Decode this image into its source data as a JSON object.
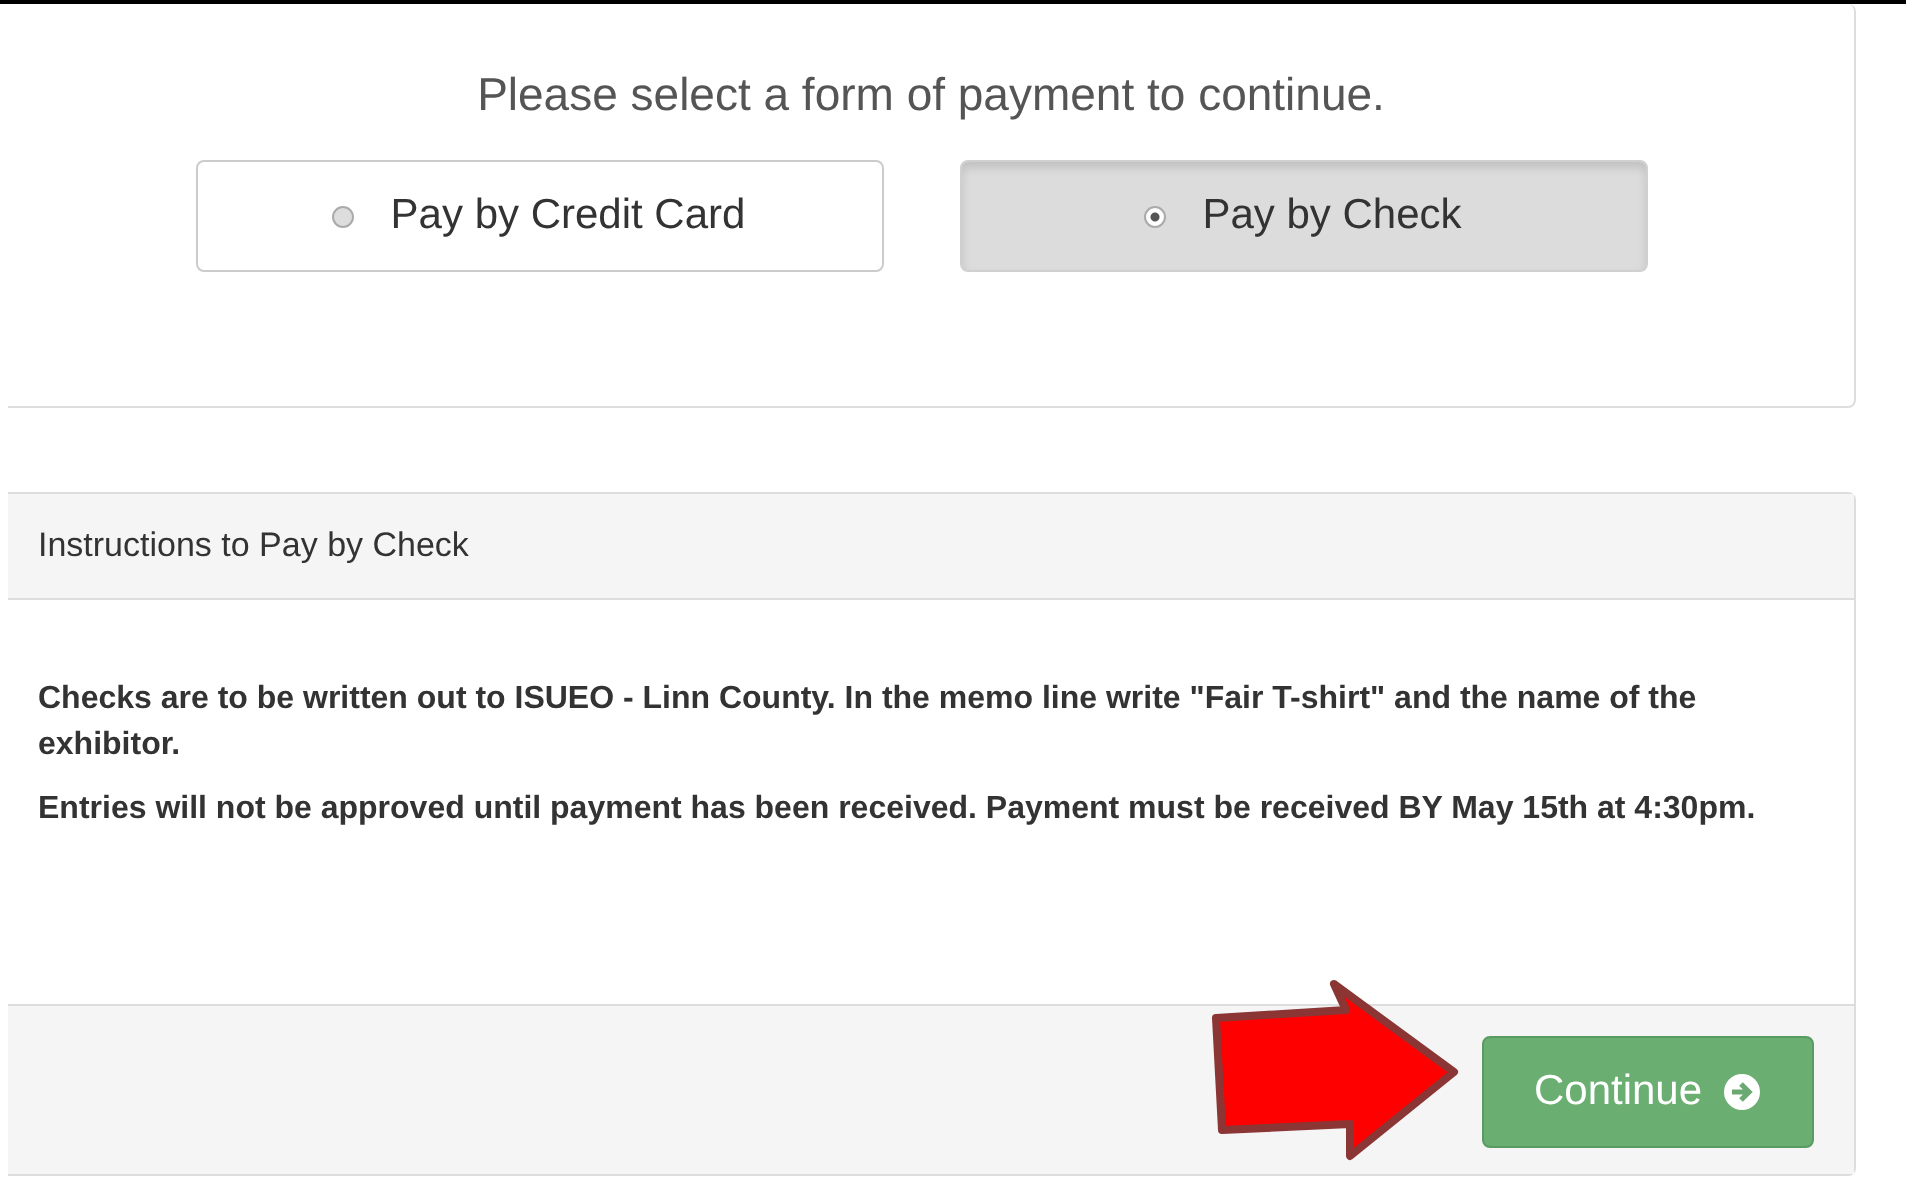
{
  "prompt": "Please select a form of payment to continue.",
  "payment_options": [
    {
      "label": "Pay by Credit Card",
      "selected": false
    },
    {
      "label": "Pay by Check",
      "selected": true
    }
  ],
  "instructions": {
    "title": "Instructions to Pay by Check",
    "paragraphs": [
      "Checks are to be written out to ISUEO - Linn County. In the memo line write \"Fair T-shirt\" and the name of the exhibitor.",
      "Entries will not be approved until payment has been received. Payment must be received BY May 15th at 4:30pm."
    ]
  },
  "continue_button": {
    "label": "Continue"
  }
}
